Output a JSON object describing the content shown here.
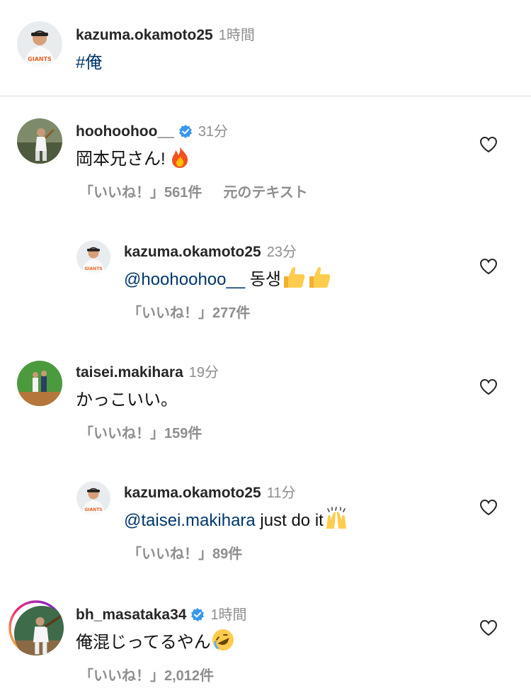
{
  "post": {
    "author": "kazuma.okamoto25",
    "time": "1時間",
    "caption": "#俺"
  },
  "comments": [
    {
      "user": "hoohoohoo__",
      "verified": true,
      "time": "31分",
      "text": "岡本兄さん! ",
      "emoji": "fire",
      "likes": "「いいね！」561件",
      "see_original": "元のテキスト"
    },
    {
      "user": "kazuma.okamoto25",
      "time": "23分",
      "mention": "@hoohoohoo__",
      "text": " 동생",
      "emoji": "thumbs-up-x2",
      "likes": "「いいね！」277件"
    },
    {
      "user": "taisei.makihara",
      "time": "19分",
      "text": "かっこいい。",
      "likes": "「いいね！」159件"
    },
    {
      "user": "kazuma.okamoto25",
      "time": "11分",
      "mention": "@taisei.makihara",
      "text": " just do it",
      "emoji": "raising-hands",
      "likes": "「いいね！」89件"
    },
    {
      "user": "bh_masataka34",
      "verified": true,
      "time": "1時間",
      "text": "俺混じってるやん",
      "emoji": "rofl",
      "likes": "「いいね！」2,012件"
    }
  ],
  "colors": {
    "text": "#111111",
    "secondary": "#8e8e8e",
    "link": "#00376b",
    "verified": "#3897f0",
    "divider": "#dbdbdb",
    "story_ring_start": "#f9ce34",
    "story_ring_end": "#ee2a7b"
  }
}
